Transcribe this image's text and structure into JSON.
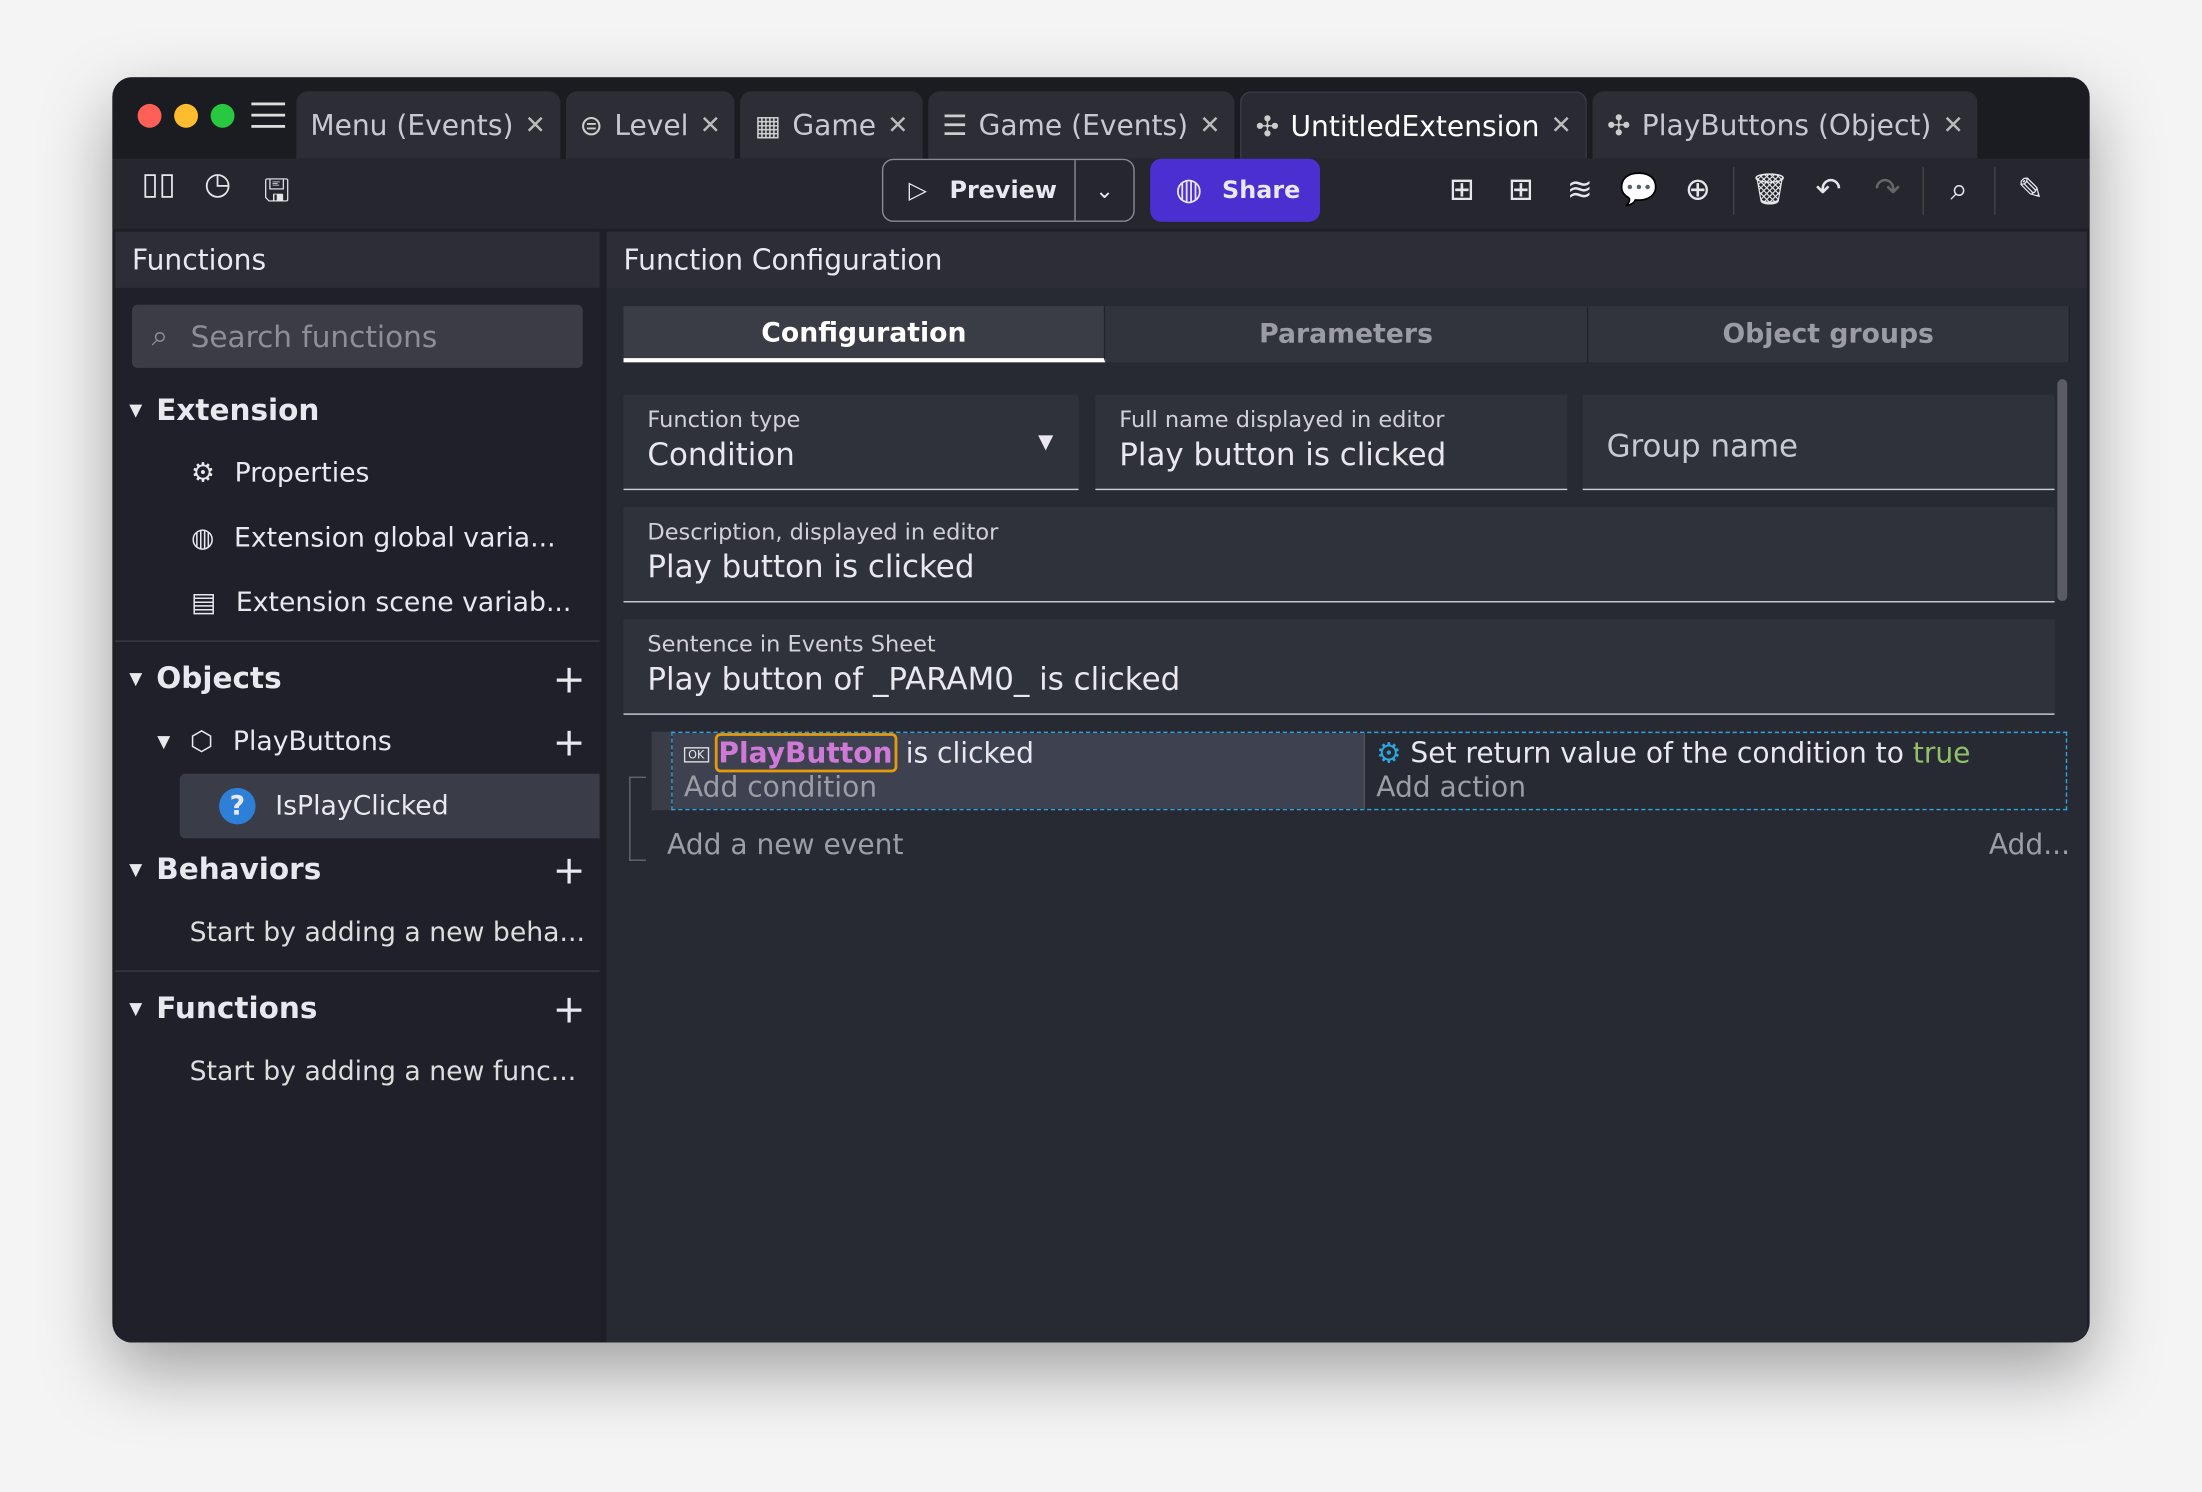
{
  "tabs": [
    {
      "label": "Menu (Events)",
      "icon": "events-icon"
    },
    {
      "label": "Level",
      "icon": "scene-icon"
    },
    {
      "label": "Game",
      "icon": "film-icon"
    },
    {
      "label": "Game (Events)",
      "icon": "events-icon"
    },
    {
      "label": "UntitledExtension",
      "icon": "puzzle-icon",
      "active": true
    },
    {
      "label": "PlayButtons (Object)",
      "icon": "puzzle-icon"
    }
  ],
  "toolbar": {
    "preview": "Preview",
    "share": "Share"
  },
  "left": {
    "title": "Functions",
    "search_placeholder": "Search functions",
    "extension": "Extension",
    "properties": "Properties",
    "global_vars": "Extension global varia...",
    "scene_vars": "Extension scene variab...",
    "objects": "Objects",
    "object_name": "PlayButtons",
    "function_name": "IsPlayClicked",
    "behaviors": "Behaviors",
    "behaviors_hint": "Start by adding a new beha...",
    "functions": "Functions",
    "functions_hint": "Start by adding a new func..."
  },
  "right": {
    "title": "Function Configuration",
    "tabs": [
      "Configuration",
      "Parameters",
      "Object groups"
    ],
    "function_type_label": "Function type",
    "function_type_value": "Condition",
    "full_name_label": "Full name displayed in editor",
    "full_name_value": "Play button is clicked",
    "group_name_placeholder": "Group name",
    "description_label": "Description, displayed in editor",
    "description_value": "Play button is clicked",
    "sentence_label": "Sentence in Events Sheet",
    "sentence_value": "Play button of _PARAM0_ is clicked"
  },
  "event": {
    "cond_object": "PlayButton",
    "cond_text": "is clicked",
    "add_condition": "Add condition",
    "action_text": "Set return value of the condition to",
    "action_value": "true",
    "add_action": "Add action",
    "add_event": "Add a new event",
    "add_more": "Add..."
  },
  "colors": {
    "accent": "#4b2fd1",
    "highlight": "#e69b0b",
    "object": "#d07ad8",
    "true": "#8fc16a"
  }
}
